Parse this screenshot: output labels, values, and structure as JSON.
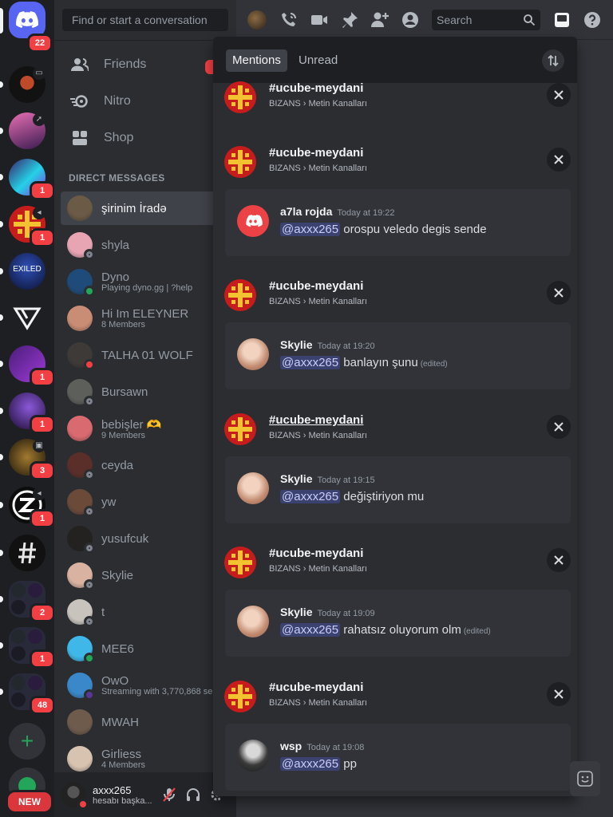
{
  "rail": {
    "home_badge": "22",
    "servers": [
      {
        "name": "speed-server",
        "badge": "",
        "mini": "screen"
      },
      {
        "name": "pink-server",
        "badge": "",
        "mini": "rocket"
      },
      {
        "name": "neon-server",
        "badge": "1",
        "mini": ""
      },
      {
        "name": "bizans-server",
        "badge": "1",
        "mini": "speaker"
      },
      {
        "name": "exiled-server",
        "label": "EXILED",
        "badge": "",
        "mini": ""
      },
      {
        "name": "triangle-server",
        "badge": "",
        "mini": ""
      },
      {
        "name": "purple-server",
        "badge": "1",
        "mini": ""
      },
      {
        "name": "violet-server",
        "badge": "1",
        "mini": ""
      },
      {
        "name": "dark-server",
        "badge": "3",
        "mini": "calendar"
      },
      {
        "name": "z-server",
        "badge": "1",
        "mini": "speaker"
      },
      {
        "name": "hash-server",
        "badge": "",
        "mini": ""
      },
      {
        "name": "folder-1",
        "badge": "2",
        "mini": ""
      },
      {
        "name": "folder-2",
        "badge": "1",
        "mini": ""
      },
      {
        "name": "folder-3",
        "badge": "48",
        "mini": ""
      }
    ],
    "new_label": "NEW"
  },
  "sidebar": {
    "search_placeholder": "Find or start a conversation",
    "nav": [
      {
        "label": "Friends",
        "badge": "2"
      },
      {
        "label": "Nitro"
      },
      {
        "label": "Shop"
      }
    ],
    "dm_header": "DIRECT MESSAGES",
    "dms": [
      {
        "name": "şirinim İradə",
        "sub": "",
        "status": "none",
        "color": "#6b5a45"
      },
      {
        "name": "shyla",
        "sub": "",
        "status": "offline",
        "color": "#e7a5b4"
      },
      {
        "name": "Dyno",
        "sub": "Playing dyno.gg | ?help",
        "status": "online",
        "color": "#1f4b7a"
      },
      {
        "name": "Hi Im ELEYNER",
        "sub": "8 Members",
        "status": "none",
        "color": "#c98c74"
      },
      {
        "name": "TALHA 01 WOLF",
        "sub": "",
        "status": "dnd",
        "color": "#3d3a38"
      },
      {
        "name": "Bursawn",
        "sub": "",
        "status": "offline",
        "color": "#5c5f5a"
      },
      {
        "name": "bebişler 🫶",
        "sub": "9 Members",
        "status": "none",
        "color": "#d96a70"
      },
      {
        "name": "ceyda",
        "sub": "",
        "status": "offline",
        "color": "#5a2f2a"
      },
      {
        "name": "yw",
        "sub": "",
        "status": "offline",
        "color": "#6b4a3a"
      },
      {
        "name": "yusufcuk",
        "sub": "",
        "status": "offline",
        "color": "#232221"
      },
      {
        "name": "Skylie",
        "sub": "",
        "status": "offline",
        "color": "#d9b2a1"
      },
      {
        "name": "t",
        "sub": "",
        "status": "offline",
        "color": "#c8c4bd"
      },
      {
        "name": "MEE6",
        "sub": "",
        "status": "online",
        "color": "#3fb7e8"
      },
      {
        "name": "OwO",
        "sub": "Streaming with 3,770,868 ser",
        "status": "streaming",
        "color": "#3a88c9"
      },
      {
        "name": "MWAH",
        "sub": "",
        "status": "none",
        "color": "#6e5b4c"
      },
      {
        "name": "Girliess",
        "sub": "4 Members",
        "status": "none",
        "color": "#d8c2b0"
      }
    ],
    "user": {
      "name": "axxx265",
      "sub": "hesabı başka..."
    }
  },
  "topbar": {
    "search_placeholder": "Search"
  },
  "inbox": {
    "tabs": [
      "Mentions",
      "Unread"
    ],
    "entries": [
      {
        "channel": "#ucube-meydani",
        "path": "BIZANS › Metin Kanalları",
        "message": null
      },
      {
        "channel": "#ucube-meydani",
        "path": "BIZANS › Metin Kanalları",
        "message": {
          "author": "a7la rojda",
          "time": "Today at 19:22",
          "mention": "@axxx265",
          "text": "orospu veledo degis sende",
          "edited": "",
          "avatar": "discord"
        }
      },
      {
        "channel": "#ucube-meydani",
        "path": "BIZANS › Metin Kanalları",
        "message": {
          "author": "Skylie",
          "time": "Today at 19:20",
          "mention": "@axxx265",
          "text": "banlayın şunu",
          "edited": "(edited)",
          "avatar": "skylie"
        }
      },
      {
        "channel": "#ucube-meydani",
        "path": "BIZANS › Metin Kanalları",
        "message": {
          "author": "Skylie",
          "time": "Today at 19:15",
          "mention": "@axxx265",
          "text": "değiştiriyon mu",
          "edited": "",
          "avatar": "skylie"
        }
      },
      {
        "channel": "#ucube-meydani",
        "path": "BIZANS › Metin Kanalları",
        "message": {
          "author": "Skylie",
          "time": "Today at 19:09",
          "mention": "@axxx265",
          "text": "rahatsız oluyorum olm",
          "edited": "(edited)",
          "avatar": "skylie"
        }
      },
      {
        "channel": "#ucube-meydani",
        "path": "BIZANS › Metin Kanalları",
        "message": {
          "author": "wsp",
          "time": "Today at 19:08",
          "mention": "@axxx265",
          "text": "pp",
          "edited": "",
          "avatar": "wsp"
        }
      }
    ]
  },
  "colors": {
    "blurple": "#5865f2",
    "red": "#f23f43",
    "green": "#23a55a",
    "grey": "#80848e"
  }
}
